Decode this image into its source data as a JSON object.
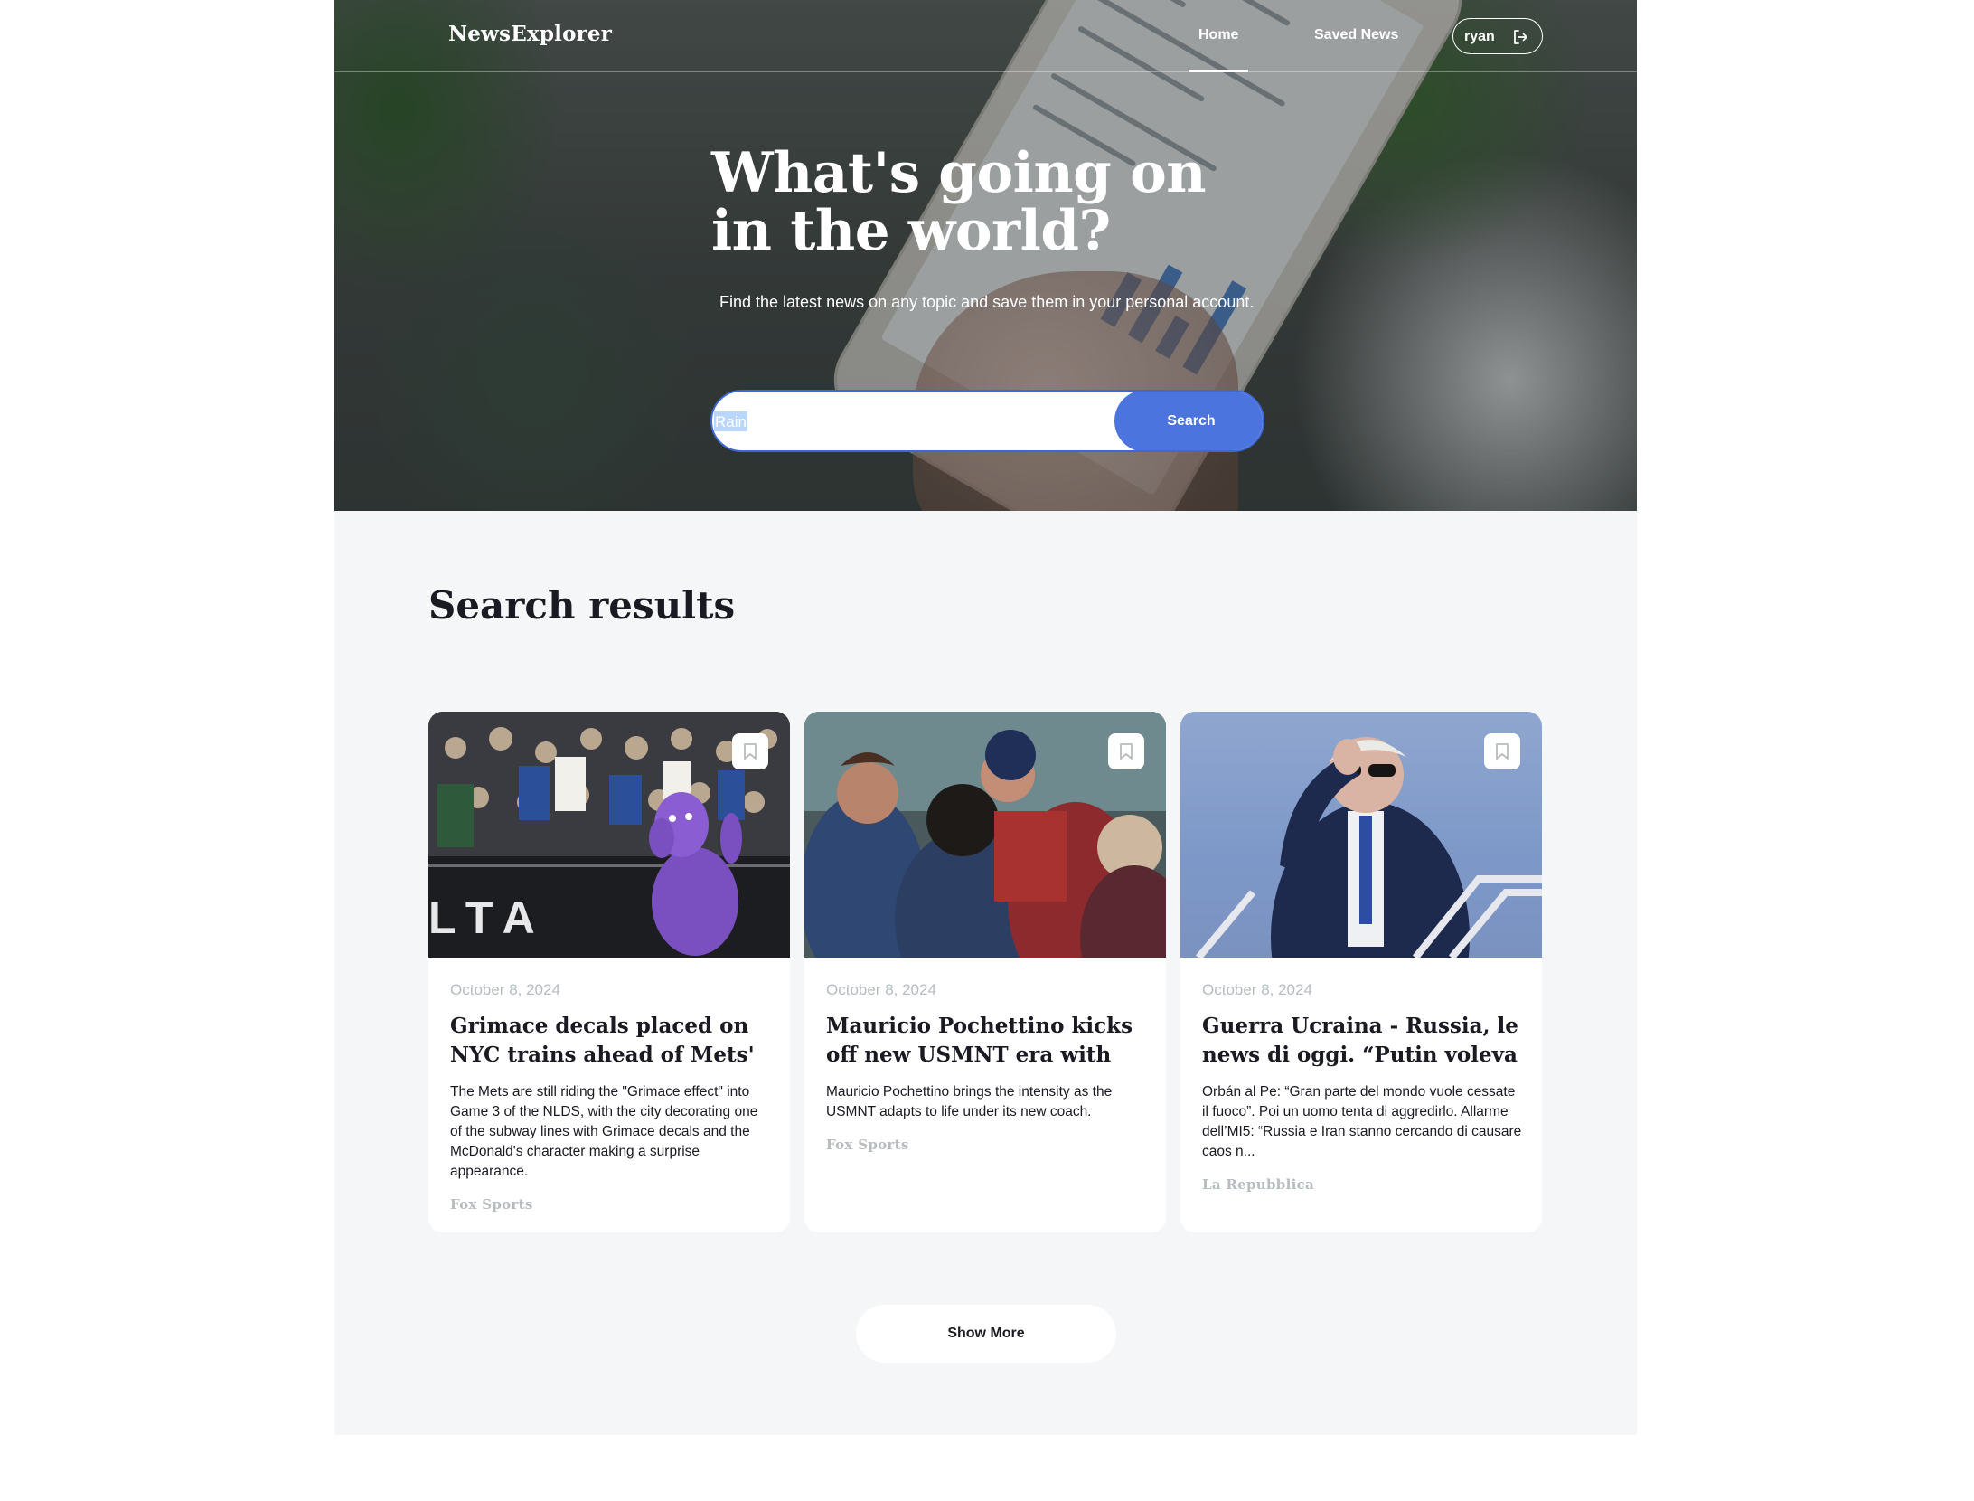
{
  "header": {
    "logo": "NewsExplorer",
    "nav": {
      "home": "Home",
      "saved": "Saved News"
    },
    "user": {
      "name": "ryan"
    }
  },
  "hero": {
    "title": "What's going on in the world?",
    "subtitle": "Find the latest news on any topic and save them in your personal account.",
    "search": {
      "value": "Rain",
      "placeholder": "",
      "button": "Search"
    }
  },
  "results": {
    "title": "Search results",
    "show_more": "Show More",
    "cards": [
      {
        "date": "October 8, 2024",
        "title": "Grimace decals placed on NYC trains ahead of Mets' first",
        "text": "The Mets are still riding the \"Grimace effect\" into Game 3 of the NLDS, with the city decorating one of the subway lines with Grimace decals and the McDonald's character making a surprise appearance.",
        "source": "Fox Sports",
        "image_text": "LTA"
      },
      {
        "date": "October 8, 2024",
        "title": "Mauricio Pochettino kicks off new USMNT era with 'tough'",
        "text": "Mauricio Pochettino brings the intensity as the USMNT adapts to life under its new coach.",
        "source": "Fox Sports"
      },
      {
        "date": "October 8, 2024",
        "title": "Guerra Ucraina - Russia, le news di oggi. “Putin voleva",
        "text": "Orbán al Pe: “Gran parte del mondo vuole cessate il fuoco”. Poi un uomo tenta di aggredirlo. Allarme dell’MI5: “Russia e Iran stanno cercando di causare caos n...",
        "source": "La Repubblica"
      }
    ]
  },
  "colors": {
    "accent": "#4b74de",
    "page_bg": "#f5f6f7",
    "text": "#1a1b22",
    "muted": "#b6bcbf"
  },
  "icons": {
    "logout": "logout-icon",
    "bookmark": "bookmark-icon"
  }
}
